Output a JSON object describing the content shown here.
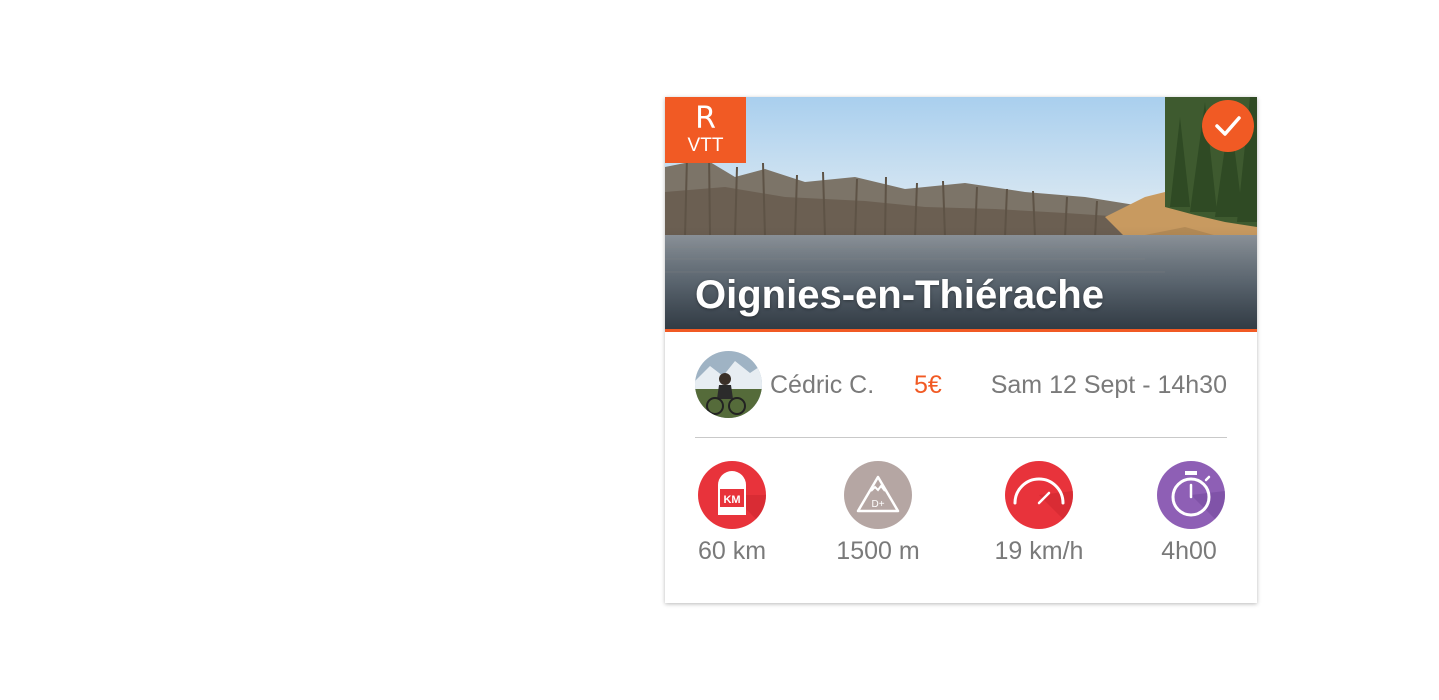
{
  "event": {
    "badge_letter": "R",
    "badge_type": "VTT",
    "title": "Oignies-en-Thiérache",
    "organizer": "Cédric C.",
    "price": "5€",
    "date": "Sam 12 Sept - 14h30"
  },
  "stats": [
    {
      "icon": "km-icon",
      "value": "60 km",
      "color": "#e8333b"
    },
    {
      "icon": "elevation-icon",
      "value": "1500 m",
      "color": "#b5a6a3"
    },
    {
      "icon": "speed-icon",
      "value": "19 km/h",
      "color": "#e8333b"
    },
    {
      "icon": "stopwatch-icon",
      "value": "4h00",
      "color": "#8e5fb5"
    }
  ],
  "colors": {
    "accent": "#f15a24",
    "text_muted": "#7a7a7a"
  }
}
